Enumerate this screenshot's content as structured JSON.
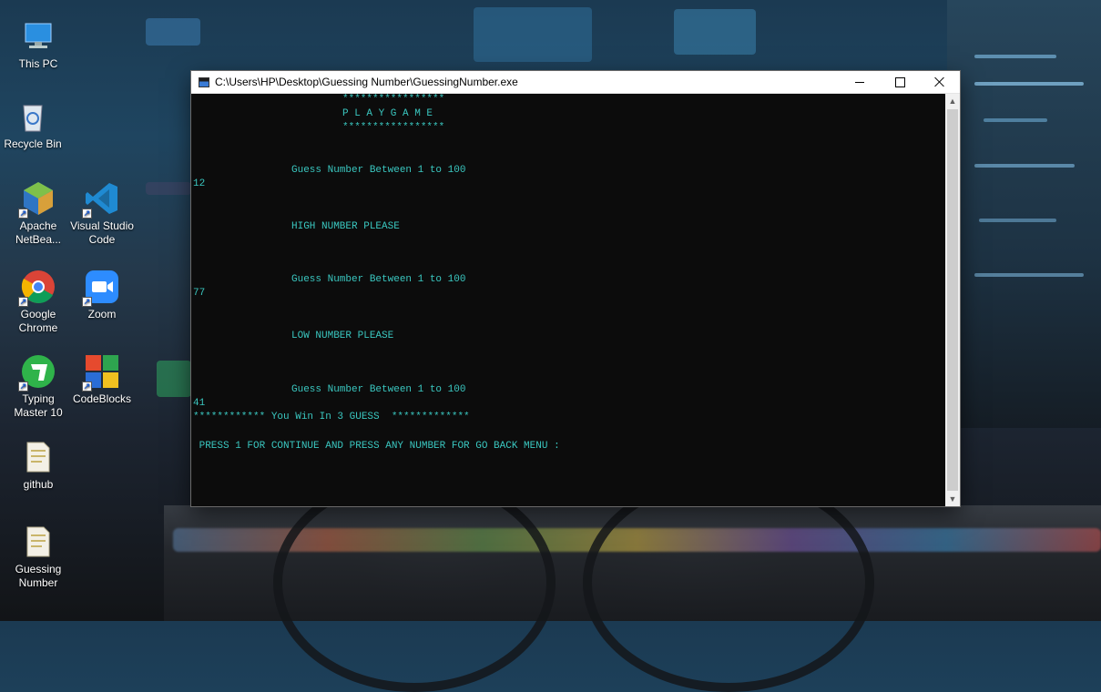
{
  "desktop": {
    "icons": [
      {
        "label": "This PC"
      },
      {
        "label": "Recycle Bin"
      },
      {
        "label": "Apache NetBea..."
      },
      {
        "label": "Visual Studio Code"
      },
      {
        "label": "Google Chrome"
      },
      {
        "label": "Zoom"
      },
      {
        "label": "Typing Master 10"
      },
      {
        "label": "CodeBlocks"
      },
      {
        "label": "github"
      },
      {
        "label": "Guessing Number"
      }
    ]
  },
  "window": {
    "title": "C:\\Users\\HP\\Desktop\\Guessing Number\\GuessingNumber.exe",
    "console_lines": [
      "*****************",
      "P L A Y G A M E",
      "*****************",
      "Guess Number Between 1 to 100",
      "12",
      "HIGH NUMBER PLEASE",
      "Guess Number Between 1 to 100",
      "77",
      "LOW NUMBER PLEASE",
      "Guess Number Between 1 to 100",
      "41",
      "************ You Win In 3 GUESS  *************",
      " PRESS 1 FOR CONTINUE AND PRESS ANY NUMBER FOR GO BACK MENU :"
    ]
  },
  "colors": {
    "console_bg": "#0c0c0c",
    "console_text": "#3ac7c0",
    "titlebar_bg": "#ffffff"
  }
}
